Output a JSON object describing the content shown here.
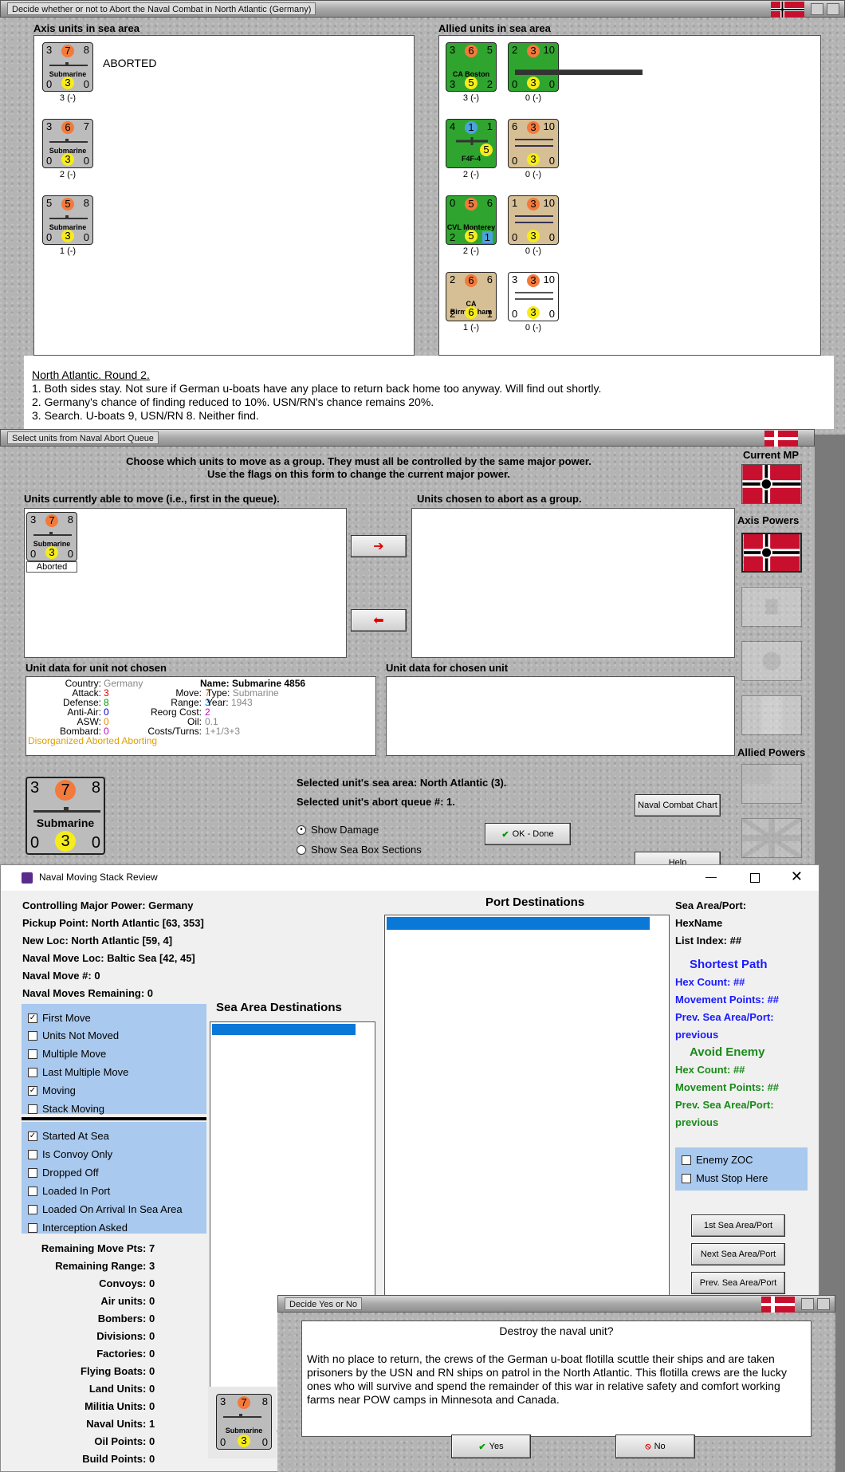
{
  "win1": {
    "title": "Decide whether or not to Abort the Naval Combat in North Atlantic (Germany)",
    "axis_header": "Axis units in sea area",
    "allied_header": "Allied units in sea area",
    "aborted_label": "ABORTED",
    "axis_units": [
      {
        "attack": "3",
        "cost": "7",
        "move": "8",
        "name": "Submarine",
        "def": "0",
        "aa": "3",
        "range": "0",
        "caption": "3 (-)"
      },
      {
        "attack": "3",
        "cost": "6",
        "move": "7",
        "name": "Submarine",
        "def": "0",
        "aa": "3",
        "range": "0",
        "caption": "2 (-)"
      },
      {
        "attack": "5",
        "cost": "5",
        "move": "8",
        "name": "Submarine",
        "def": "0",
        "aa": "3",
        "range": "0",
        "caption": "1 (-)"
      }
    ],
    "allied_units": [
      {
        "attack": "3",
        "cost": "6",
        "move": "5",
        "name": "CA Boston",
        "def": "3",
        "aa": "5",
        "range": "2",
        "caption": "3 (-)",
        "color": "green"
      },
      {
        "attack": "2",
        "cost": "3",
        "move": "10",
        "name": "",
        "def": "0",
        "aa": "3",
        "range": "0",
        "caption": "0 (-)",
        "color": "green"
      },
      {
        "attack": "4",
        "cost": "1",
        "move": "1",
        "name": "F4F-4",
        "def": "",
        "aa": "5",
        "range": "",
        "caption": "2 (-)",
        "color": "green"
      },
      {
        "attack": "6",
        "cost": "3",
        "move": "10",
        "name": "",
        "def": "0",
        "aa": "3",
        "range": "0",
        "caption": "0 (-)",
        "color": "tan"
      },
      {
        "attack": "0",
        "cost": "5",
        "move": "6",
        "name": "CVL Monterey",
        "def": "2",
        "aa": "5",
        "range": "1",
        "caption": "2 (-)",
        "color": "green"
      },
      {
        "attack": "1",
        "cost": "3",
        "move": "10",
        "name": "",
        "def": "0",
        "aa": "3",
        "range": "0",
        "caption": "0 (-)",
        "color": "tan"
      },
      {
        "attack": "2",
        "cost": "6",
        "move": "6",
        "name": "CA Birmingham",
        "def": "2",
        "aa": "6",
        "range": "1",
        "caption": "1 (-)",
        "color": "tan"
      },
      {
        "attack": "3",
        "cost": "3",
        "move": "10",
        "name": "",
        "def": "0",
        "aa": "3",
        "range": "0",
        "caption": "0 (-)",
        "color": "white"
      }
    ],
    "notes": [
      "North Atlantic.  Round 2.",
      "1. Both sides stay.  Not sure if German u-boats have any place to return back home too anyway.  Will find out shortly.",
      "2. Germany's chance of finding reduced to 10%.  USN/RN's chance remains 20%.",
      "3. Search. U-boats 9, USN/RN 8.  Neither find."
    ]
  },
  "win2": {
    "title": "Select units from Naval Abort Queue",
    "instructions": [
      "Choose which units to move as a group.  They must all be controlled by the same major power.",
      "Use the flags on this form to change the current major power."
    ],
    "able_label": "Units currently able to move (i.e., first in the queue).",
    "chosen_label": "Units chosen to abort as a group.",
    "unit": {
      "attack": "3",
      "cost": "7",
      "move": "8",
      "name": "Submarine",
      "def": "0",
      "aa": "3",
      "range": "0",
      "status": "Aborted"
    },
    "not_chosen_label": "Unit data for unit not chosen",
    "chosen_data_label": "Unit data for chosen unit",
    "data": {
      "country_k": "Country:",
      "country_v": "Germany",
      "attack_k": "Attack:",
      "attack_v": "3",
      "defense_k": "Defense:",
      "defense_v": "8",
      "aa_k": "Anti-Air:",
      "aa_v": "0",
      "asw_k": "ASW:",
      "asw_v": "0",
      "bombard_k": "Bombard:",
      "bombard_v": "0",
      "move_k": "Move:",
      "move_v": "7",
      "range_k": "Range:",
      "range_v": "3",
      "reorg_k": "Reorg Cost:",
      "reorg_v": "2",
      "oil_k": "Oil:",
      "oil_v": "0.1",
      "costs_k": "Costs/Turns:",
      "costs_v": "1+1/3+3",
      "name": "Name: Submarine 4856",
      "type_k": "Type:",
      "type_v": "Submarine",
      "year_k": "Year:",
      "year_v": "1943",
      "status": "Disorganized Aborted Aborting"
    },
    "big_unit": {
      "attack": "3",
      "cost": "7",
      "move": "8",
      "name": "Submarine",
      "def": "0",
      "aa": "3",
      "range": "0"
    },
    "sea_area": "Selected unit's sea area: North Atlantic (3).",
    "queue": "Selected unit's abort queue #: 1.",
    "show_damage": "Show Damage",
    "show_sea_box": "Show Sea Box Sections",
    "ok_label": "OK - Done",
    "chart_label": "Naval Combat Chart",
    "help_label": "Help",
    "current_mp": "Current MP",
    "axis_powers": "Axis Powers",
    "allied_powers": "Allied Powers"
  },
  "win3": {
    "title": "Naval Moving Stack Review",
    "info": [
      "Controlling Major Power:  Germany",
      "Pickup Point:  North Atlantic [63, 353]",
      "New Loc:  North Atlantic [59, 4]",
      "Naval Move Loc:  Baltic Sea [42, 45]",
      "Naval Move #:  0",
      "Naval Moves Remaining:  0"
    ],
    "checks1": [
      {
        "label": "First Move",
        "checked": "✓"
      },
      {
        "label": "Units Not Moved",
        "checked": ""
      },
      {
        "label": "Multiple Move",
        "checked": ""
      },
      {
        "label": "Last Multiple Move",
        "checked": ""
      },
      {
        "label": "Moving",
        "checked": "✓"
      },
      {
        "label": "Stack Moving",
        "checked": ""
      }
    ],
    "checks2": [
      {
        "label": "Started At Sea",
        "checked": "✓"
      },
      {
        "label": "Is Convoy Only",
        "checked": ""
      },
      {
        "label": "Dropped Off",
        "checked": ""
      },
      {
        "label": "Loaded In Port",
        "checked": ""
      },
      {
        "label": "Loaded On Arrival In Sea Area",
        "checked": ""
      },
      {
        "label": "Interception Asked",
        "checked": ""
      }
    ],
    "stats": [
      {
        "k": "Remaining Move Pts:",
        "v": "7"
      },
      {
        "k": "Remaining Range:",
        "v": "3"
      },
      {
        "k": "Convoys:",
        "v": "0"
      },
      {
        "k": "Air units:",
        "v": "0"
      },
      {
        "k": "Bombers:",
        "v": "0"
      },
      {
        "k": "Divisions:",
        "v": "0"
      },
      {
        "k": "Factories:",
        "v": "0"
      },
      {
        "k": "Flying Boats:",
        "v": "0"
      },
      {
        "k": "Land Units:",
        "v": "0"
      },
      {
        "k": "Militia Units:",
        "v": "0"
      },
      {
        "k": "Naval Units:",
        "v": "1"
      },
      {
        "k": "Oil Points:",
        "v": "0"
      },
      {
        "k": "Build Points:",
        "v": "0"
      }
    ],
    "sea_dest": "Sea Area Destinations",
    "port_dest": "Port Destinations",
    "right": {
      "sea_port": "Sea Area/Port:",
      "hexname": "HexName",
      "list_index": "List Index:  ##",
      "shortest": "Shortest Path",
      "hex_count": "Hex Count:  ##",
      "mp": "Movement Points:  ##",
      "prev": "Prev. Sea Area/Port:",
      "previous": "previous",
      "avoid": "Avoid Enemy",
      "hex_count2": "Hex Count:  ##",
      "mp2": "Movement Points:  ##",
      "prev2": "Prev. Sea Area/Port:",
      "previous2": "previous",
      "zoc": "Enemy ZOC",
      "stop": "Must Stop Here",
      "btn1": "1st Sea Area/Port",
      "btn2": "Next Sea Area/Port",
      "btn3": "Prev. Sea Area/Port"
    },
    "unit": {
      "attack": "3",
      "cost": "7",
      "move": "8",
      "name": "Submarine",
      "def": "0",
      "aa": "3",
      "range": "0"
    }
  },
  "win4": {
    "title": "Decide Yes or No",
    "question": "Destroy the naval unit?",
    "body": "With no place to return, the crews of the German u-boat flotilla scuttle their ships and are taken prisoners by the USN and RN ships on patrol in the North Atlantic.  This flotilla crews are the lucky ones who will survive  and spend the remainder of this war in relative safety and comfort working farms near POW camps in Minnesota and Canada.",
    "yes": "Yes",
    "no": "No"
  }
}
